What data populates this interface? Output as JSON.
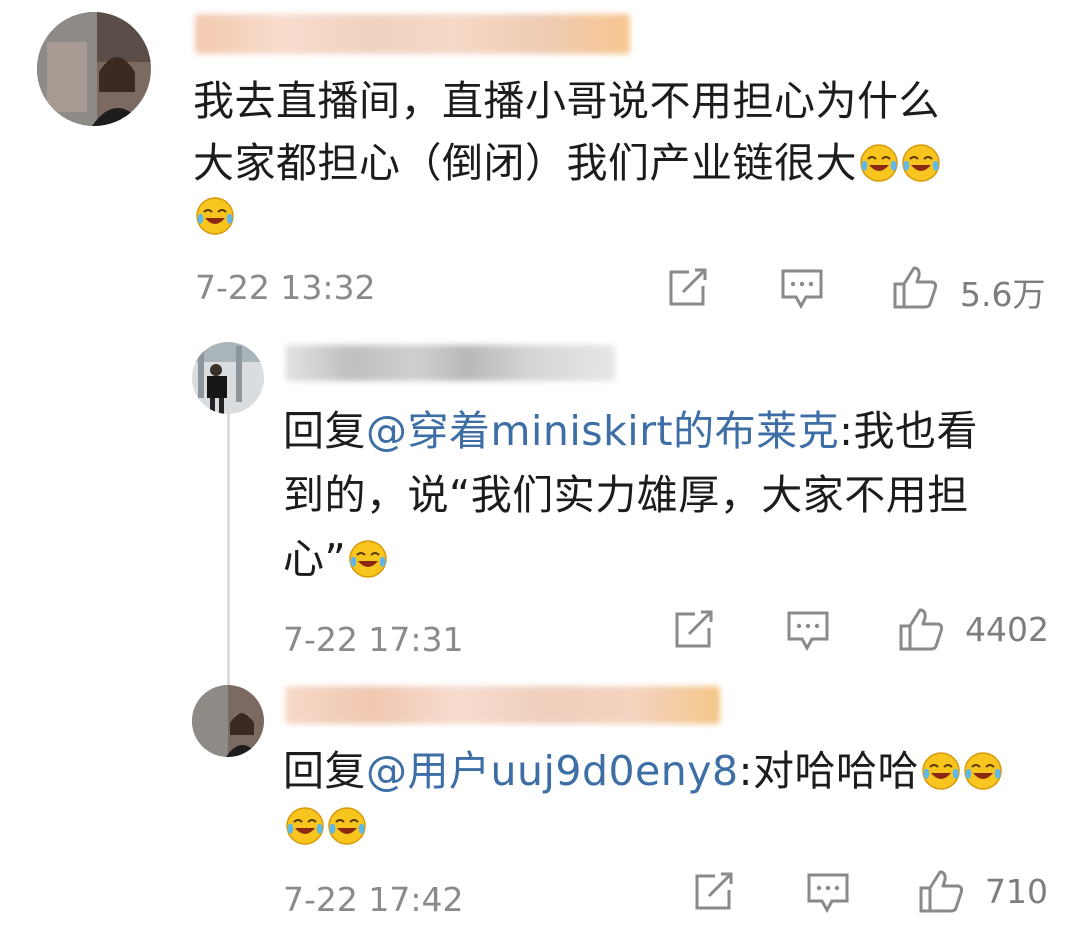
{
  "colors": {
    "mention": "#3d6ea5",
    "meta": "#8a8a8a",
    "text": "#1c1c1c"
  },
  "main_comment": {
    "text_line1": "我去直播间，直播小哥说不用担心为什么",
    "text_line2": "大家都担心（倒闭）我们产业链很大",
    "timestamp": "7-22 13:32",
    "likes": "5.6万",
    "emoji_icon": "laugh-cry-emoji"
  },
  "reply1": {
    "prefix": "回复",
    "mention": "@穿着miniskirt的布莱克",
    "line1_rest": ":我也看",
    "line2": "到的，说“我们实力雄厚，大家不用担",
    "line3": "心”",
    "timestamp": "7-22 17:31",
    "likes": "4402"
  },
  "reply2": {
    "prefix": "回复",
    "mention": "@用户uuj9d0eny8",
    "rest": ":对哈哈哈",
    "timestamp": "7-22 17:42",
    "likes": "710"
  },
  "icons": [
    "share-icon",
    "comment-icon",
    "like-icon"
  ]
}
